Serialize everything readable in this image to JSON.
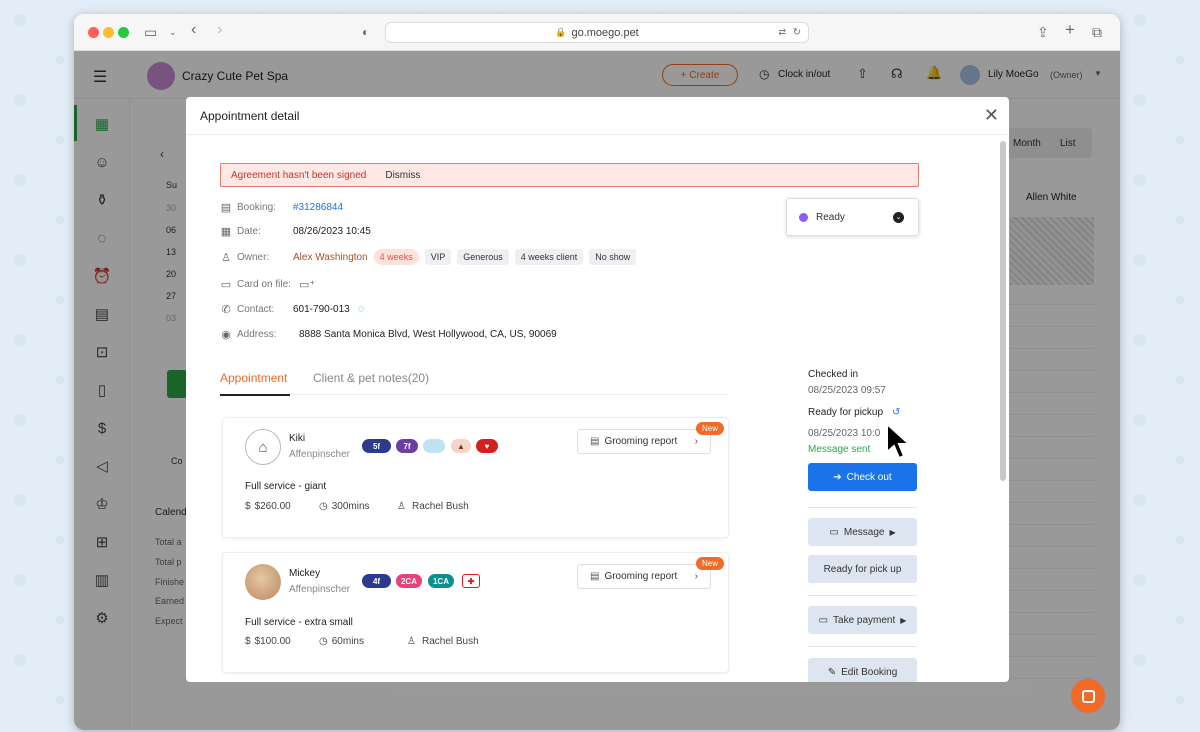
{
  "browser": {
    "url": "go.moego.pet",
    "traffic_colors": [
      "#ff5f57",
      "#febc2e",
      "#28c840"
    ]
  },
  "app": {
    "business_name": "Crazy Cute Pet Spa",
    "create_label": "+ Create",
    "clock_label": "Clock in/out",
    "user_name": "Lily MoeGo",
    "user_role": "(Owner)",
    "accent": "#f06a28",
    "primary": "#1a73e8"
  },
  "background": {
    "calendar_days": [
      "Su",
      "30",
      "06",
      "13",
      "20",
      "27",
      "03"
    ],
    "view_month": "Month",
    "view_list": "List",
    "staff_column": "Allen White",
    "calendar_title": "Calend",
    "summary_rows": [
      "Total a",
      "Total p",
      "Finishe",
      "Earned",
      "Expect"
    ],
    "left_panel_label": "Co"
  },
  "modal": {
    "title": "Appointment detail",
    "alert_text": "Agreement hasn't been signed",
    "dismiss": "Dismiss",
    "booking_label": "Booking:",
    "booking_value": "#31286844",
    "date_label": "Date:",
    "date_value": "08/26/2023 10:45",
    "owner_label": "Owner:",
    "owner_name": "Alex Washington",
    "owner_tags": [
      "4 weeks",
      "VIP",
      "Generous",
      "4 weeks client",
      "No show"
    ],
    "card_label": "Card on file:",
    "contact_label": "Contact:",
    "contact_value": "601-790-013",
    "address_label": "Address:",
    "address_value": "8888 Santa Monica Blvd, West Hollywood, CA, US, 90069",
    "status": "Ready",
    "status_color": "#8b5cf6",
    "tabs": [
      "Appointment",
      "Client & pet notes(20)"
    ],
    "pets": [
      {
        "name": "Kiki",
        "breed": "Affenpinscher",
        "chips": [
          "5f",
          "7f"
        ],
        "grooming_report": "Grooming report",
        "new_badge": "New",
        "service": "Full service - giant",
        "price": "$260.00",
        "duration": "300mins",
        "staff": "Rachel Bush"
      },
      {
        "name": "Mickey",
        "breed": "Affenpinscher",
        "chips": [
          "4f",
          "2CA",
          "1CA"
        ],
        "grooming_report": "Grooming report",
        "new_badge": "New",
        "service": "Full service - extra small",
        "price": "$100.00",
        "duration": "60mins",
        "staff": "Rachel Bush"
      }
    ],
    "side": {
      "checked_in_label": "Checked in",
      "checked_in_time": "08/25/2023 09:57",
      "ready_label": "Ready for pickup",
      "ready_time": "08/25/2023 10:0",
      "message_sent": "Message sent",
      "checkout": "Check out",
      "message": "Message",
      "ready_btn": "Ready for pick up",
      "take_payment": "Take payment",
      "edit_booking": "Edit Booking"
    }
  }
}
